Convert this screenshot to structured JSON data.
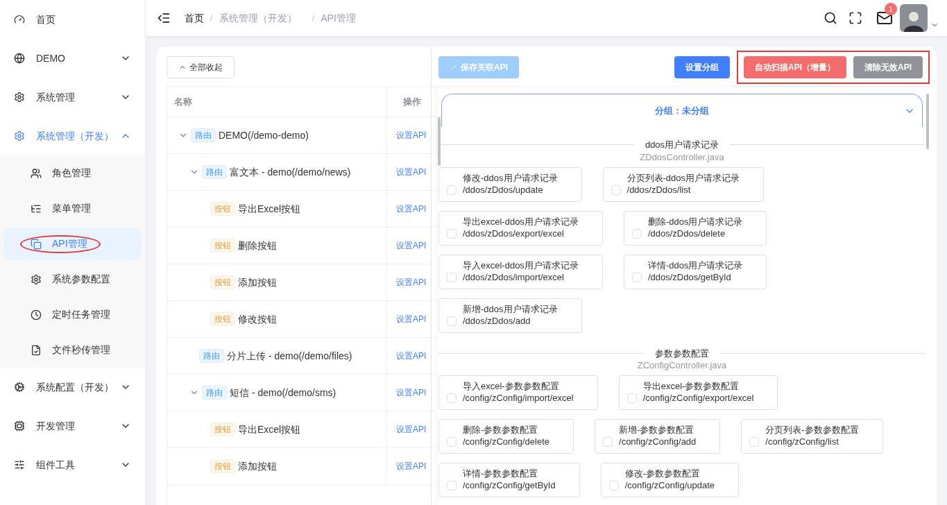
{
  "sidebar": {
    "items": [
      {
        "label": "首页",
        "selected": false
      },
      {
        "label": "DEMO",
        "selected": false,
        "expanded": false
      },
      {
        "label": "系统管理",
        "selected": false,
        "expanded": false
      },
      {
        "label": "系统管理（开发）",
        "selected": true,
        "expanded": true,
        "children": [
          {
            "label": "角色管理",
            "selected": false
          },
          {
            "label": "菜单管理",
            "selected": false
          },
          {
            "label": "API管理",
            "selected": true
          },
          {
            "label": "系统参数配置",
            "selected": false
          },
          {
            "label": "定时任务管理",
            "selected": false
          },
          {
            "label": "文件秒传管理",
            "selected": false
          }
        ]
      },
      {
        "label": "系统配置（开发）",
        "selected": false,
        "expanded": false
      },
      {
        "label": "开发管理",
        "selected": false,
        "expanded": false
      },
      {
        "label": "组件工具",
        "selected": false,
        "expanded": false
      }
    ]
  },
  "header": {
    "breadcrumb": [
      "首页",
      "系统管理（开发）",
      "API管理"
    ],
    "separator": "/",
    "notifications": "1"
  },
  "tree_panel": {
    "collapse_button": "全部收起",
    "columns": [
      "名称",
      "操作"
    ],
    "tree": [
      {
        "kind": "route",
        "tag": "路由",
        "label": "DEMO(/demo-demo)",
        "action": "设置API",
        "expanded": true,
        "children": [
          {
            "kind": "route",
            "tag": "路由",
            "label": "富文本 - demo(/demo/news)",
            "action": "设置API",
            "expanded": true,
            "children": [
              {
                "kind": "button",
                "tag": "按钮",
                "label": "导出Excel按钮",
                "action": "设置API"
              },
              {
                "kind": "button",
                "tag": "按钮",
                "label": "删除按钮",
                "action": "设置API"
              },
              {
                "kind": "button",
                "tag": "按钮",
                "label": "添加按钮",
                "action": "设置API"
              },
              {
                "kind": "button",
                "tag": "按钮",
                "label": "修改按钮",
                "action": "设置API"
              }
            ]
          },
          {
            "kind": "route",
            "tag": "路由",
            "label": "分片上传 - demo(/demo/files)",
            "action": "设置API"
          },
          {
            "kind": "route",
            "tag": "路由",
            "label": "短信 - demo(/demo/sms)",
            "action": "设置API",
            "expanded": true,
            "children": [
              {
                "kind": "button",
                "tag": "按钮",
                "label": "导出Excel按钮",
                "action": "设置API"
              },
              {
                "kind": "button",
                "tag": "按钮",
                "label": "添加按钮",
                "action": "设置API"
              }
            ]
          }
        ]
      }
    ]
  },
  "api_panel": {
    "buttons": [
      {
        "kind": "save",
        "label": "保存关联API",
        "disabled": true
      },
      {
        "kind": "primary",
        "label": "设置分组",
        "disabled": false
      },
      {
        "kind": "danger",
        "label": "自动扫描API（增量）",
        "disabled": false
      },
      {
        "kind": "info",
        "label": "清除无效API",
        "disabled": false
      }
    ],
    "group": {
      "title": "分组：未分组",
      "expanded": true,
      "sections": [
        {
          "title": "ddos用户请求记录",
          "file": "ZDdosController.java",
          "apis": [
            {
              "name": "修改-ddos用户请求记录",
              "path": "/ddos/zDdos/update",
              "checked": false
            },
            {
              "name": "分页列表-ddos用户请求记录",
              "path": "/ddos/zDdos/list",
              "checked": false
            },
            {
              "name": "导出excel-ddos用户请求记录",
              "path": "/ddos/zDdos/export/excel",
              "checked": false
            },
            {
              "name": "删除-ddos用户请求记录",
              "path": "/ddos/zDdos/delete",
              "checked": false
            },
            {
              "name": "导入excel-ddos用户请求记录",
              "path": "/ddos/zDdos/import/excel",
              "checked": false
            },
            {
              "name": "详情-ddos用户请求记录",
              "path": "/ddos/zDdos/getById",
              "checked": false
            },
            {
              "name": "新增-ddos用户请求记录",
              "path": "/ddos/zDdos/add",
              "checked": false
            }
          ]
        },
        {
          "title": "参数参数配置",
          "file": "ZConfigController.java",
          "apis": [
            {
              "name": "导入excel-参数参数配置",
              "path": "/config/zConfig/import/excel",
              "checked": false
            },
            {
              "name": "导出excel-参数参数配置",
              "path": "/config/zConfig/export/excel",
              "checked": false
            },
            {
              "name": "删除-参数参数配置",
              "path": "/config/zConfig/delete",
              "checked": false
            },
            {
              "name": "新增-参数参数配置",
              "path": "/config/zConfig/add",
              "checked": false
            },
            {
              "name": "分页列表-参数参数配置",
              "path": "/config/zConfig/list",
              "checked": false
            },
            {
              "name": "详情-参数参数配置",
              "path": "/config/zConfig/getById",
              "checked": false
            },
            {
              "name": "修改-参数参数配置",
              "path": "/config/zConfig/update",
              "checked": false
            }
          ]
        }
      ]
    }
  }
}
